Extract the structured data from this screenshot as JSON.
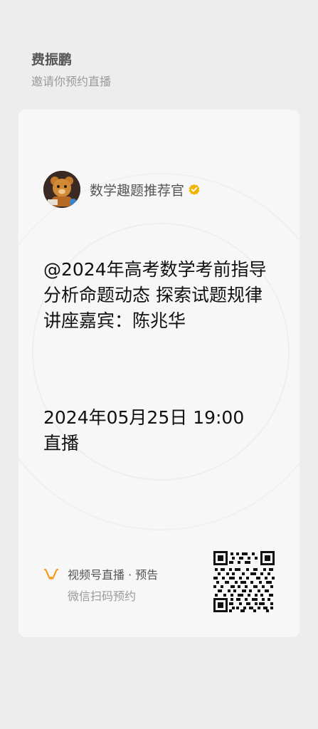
{
  "inviter": {
    "name": "费振鹏",
    "subtitle": "邀请你预约直播"
  },
  "account": {
    "name": "数学趣题推荐官",
    "verified_color": "#f2b400"
  },
  "live": {
    "title_lines": [
      "@2024年高考数学考前指导",
      "分析命题动态 探索试题规律",
      "讲座嘉宾：陈兆华"
    ],
    "datetime": "2024年05月25日 19:00",
    "status": "直播"
  },
  "footer": {
    "channel_label": "视频号直播 · 预告",
    "scan_hint": "微信扫码预约",
    "accent": "#f39c1f"
  }
}
